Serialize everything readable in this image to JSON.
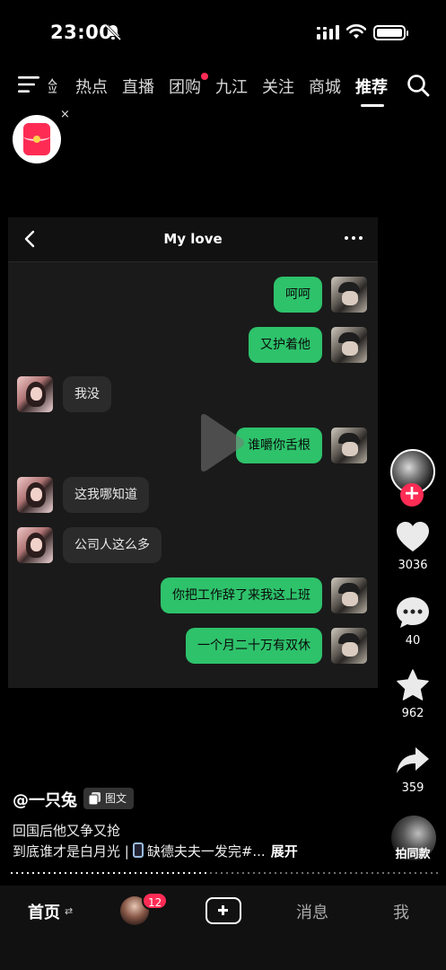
{
  "status_bar": {
    "time": "23:00"
  },
  "top_nav": {
    "tabs": [
      {
        "label": "验",
        "active": false,
        "dot": false
      },
      {
        "label": "热点",
        "active": false,
        "dot": false
      },
      {
        "label": "直播",
        "active": false,
        "dot": false
      },
      {
        "label": "团购",
        "active": false,
        "dot": true
      },
      {
        "label": "九江",
        "active": false,
        "dot": false
      },
      {
        "label": "关注",
        "active": false,
        "dot": false
      },
      {
        "label": "商城",
        "active": false,
        "dot": false
      },
      {
        "label": "推荐",
        "active": true,
        "dot": false
      }
    ]
  },
  "redpack": {
    "close": "×"
  },
  "chat": {
    "title": "My love",
    "messages": [
      {
        "from": "me",
        "text": "呵呵"
      },
      {
        "from": "me",
        "text": "又护着他"
      },
      {
        "from": "her",
        "text": "我没"
      },
      {
        "from": "me",
        "text": "谁嚼你舌根"
      },
      {
        "from": "her",
        "text": "这我哪知道"
      },
      {
        "from": "her",
        "text": "公司人这么多"
      },
      {
        "from": "me",
        "text": "你把工作辞了来我这上班"
      },
      {
        "from": "me",
        "text": "一个月二十万有双休"
      }
    ]
  },
  "rail": {
    "follow_plus": "+",
    "likes": "3036",
    "comments": "40",
    "favorites": "962",
    "shares": "359",
    "same_style": "拍同款"
  },
  "caption": {
    "author": "@一只兔",
    "tag": "图文",
    "line1": "回国后他又争又抢",
    "line2_a": "到底谁才是白月光 |",
    "line2_b": "缺德夫夫一发完#...",
    "expand": "展开"
  },
  "bottom_bar": {
    "home": "首页",
    "swap": "⇄",
    "badge": "12",
    "messages": "消息",
    "me": "我"
  },
  "colors": {
    "accent": "#fe2c55",
    "bubble_out": "#2ec26b",
    "bubble_in": "#2b2b2b"
  }
}
